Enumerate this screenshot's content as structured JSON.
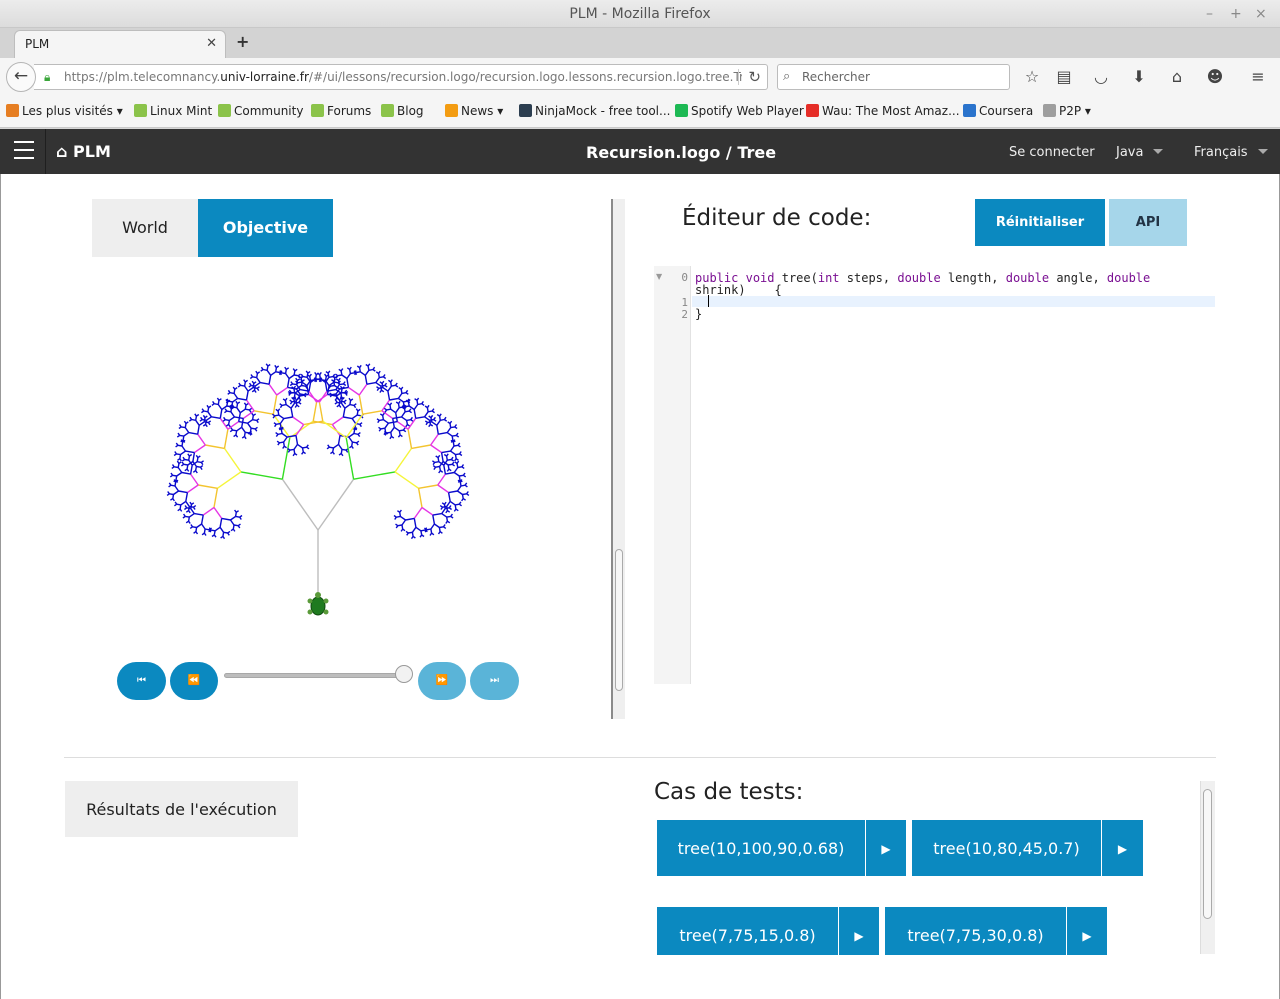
{
  "window": {
    "title": "PLM - Mozilla Firefox"
  },
  "tab": {
    "label": "PLM"
  },
  "nav": {
    "url_prefix": "https://plm.telecomnancy.",
    "url_domain": "univ-lorraine.fr",
    "url_suffix": "/#/ui/lessons/recursion.logo/recursion.logo.lessons.recursion.logo.tree.Tre",
    "search_placeholder": "Rechercher"
  },
  "bookmarks": [
    {
      "label": "Les plus visités",
      "color": "#e67e22",
      "dropdown": true
    },
    {
      "label": "Linux Mint",
      "color": "#8bc34a"
    },
    {
      "label": "Community",
      "color": "#8bc34a"
    },
    {
      "label": "Forums",
      "color": "#8bc34a"
    },
    {
      "label": "Blog",
      "color": "#8bc34a"
    },
    {
      "label": "News",
      "color": "#f39c12",
      "dropdown": true
    },
    {
      "label": "NinjaMock - free tool...",
      "color": "#2c3e50"
    },
    {
      "label": "Spotify Web Player",
      "color": "#1db954"
    },
    {
      "label": "Wau: The Most Amaz...",
      "color": "#e52d27"
    },
    {
      "label": "Coursera",
      "color": "#2a73cc"
    },
    {
      "label": "P2P",
      "color": "#9e9e9e",
      "dropdown": true
    }
  ],
  "app": {
    "brand": "PLM",
    "title": "Recursion.logo / Tree",
    "login": "Se connecter",
    "language_prog": "Java",
    "language_human": "Français"
  },
  "world_tabs": {
    "world": "World",
    "objective": "Objective"
  },
  "player": {
    "first": "⏮",
    "prev": "⏪",
    "next": "⏩",
    "last": "⏭",
    "position": 1.0
  },
  "editor": {
    "title": "Éditeur de code:",
    "reset_label": "Réinitialiser",
    "api_label": "API",
    "line_numbers": [
      "0",
      "1",
      "2"
    ],
    "line0_a": "public",
    "line0_b": "void",
    "line0_c": " tree(",
    "line0_d": "int",
    "line0_e": " steps, ",
    "line0_f": "double",
    "line0_g": " length, ",
    "line0_h": "double",
    "line0_i": " angle, ",
    "line0_j": "double",
    "line0_wrap": "shrink)    {",
    "line2": "}"
  },
  "results": {
    "label": "Résultats de l'exécution"
  },
  "tests": {
    "title": "Cas de tests:",
    "run_icon": "▶",
    "cases": [
      "tree(10,100,90,0.68)",
      "tree(10,80,45,0.7)",
      "tree(7,75,15,0.8)",
      "tree(7,75,30,0.8)"
    ]
  },
  "tree_colors": [
    "#bdbdbd",
    "#33dd22",
    "#f5f53a",
    "#f3c42f",
    "#e535e5",
    "#0a0acc"
  ],
  "colors": {
    "accent": "#0b89c0",
    "accent_light": "#a6d6ea",
    "appbar": "#333333"
  }
}
